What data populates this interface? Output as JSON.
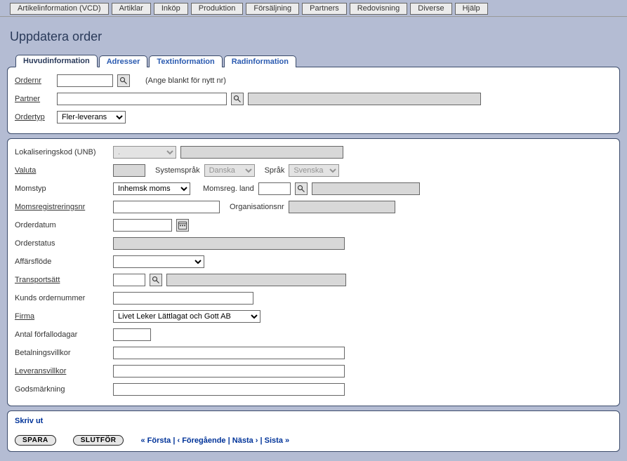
{
  "menu": {
    "items": [
      "Artikelinformation (VCD)",
      "Artiklar",
      "Inköp",
      "Produktion",
      "Försäljning",
      "Partners",
      "Redovisning",
      "Diverse",
      "Hjälp"
    ]
  },
  "page": {
    "title": "Uppdatera order"
  },
  "tabs": {
    "huvud": "Huvudinformation",
    "adresser": "Adresser",
    "textinfo": "Textinformation",
    "radinfo": "Radinformation"
  },
  "fields": {
    "ordernr_label": "Ordernr",
    "ordernr_hint": "(Ange blankt för nytt nr)",
    "partner_label": "Partner",
    "ordertyp_label": "Ordertyp",
    "ordertyp_value": "Fler-leverans",
    "lokal_label": "Lokaliseringskod (UNB)",
    "lokal_value": ".",
    "valuta_label": "Valuta",
    "systemsprak_label": "Systemspråk",
    "systemsprak_value": "Danska",
    "sprak_label": "Språk",
    "sprak_value": "Svenska",
    "momstyp_label": "Momstyp",
    "momstyp_value": "Inhemsk moms",
    "momsreg_land_label": "Momsreg. land",
    "momsreg_nr_label": "Momsregistreringsnr",
    "orgnr_label": "Organisationsnr",
    "orderdatum_label": "Orderdatum",
    "orderstatus_label": "Orderstatus",
    "affarsflode_label": "Affärsflöde",
    "transportsatt_label": "Transportsätt",
    "kunds_ordernr_label": "Kunds ordernummer",
    "firma_label": "Firma",
    "firma_value": "Livet Leker Lättlagat och Gott AB",
    "antal_forfallo_label": "Antal förfallodagar",
    "betalningsvillkor_label": "Betalningsvillkor",
    "leveransvillkor_label": "Leveransvillkor",
    "godsmarkning_label": "Godsmärkning"
  },
  "footer": {
    "print": "Skriv ut",
    "save": "SPARA",
    "finish": "SLUTFÖR",
    "pager_first": "« Första",
    "pager_prev": "‹ Föregående",
    "pager_next": "Nästa ›",
    "pager_last": "Sista »"
  }
}
